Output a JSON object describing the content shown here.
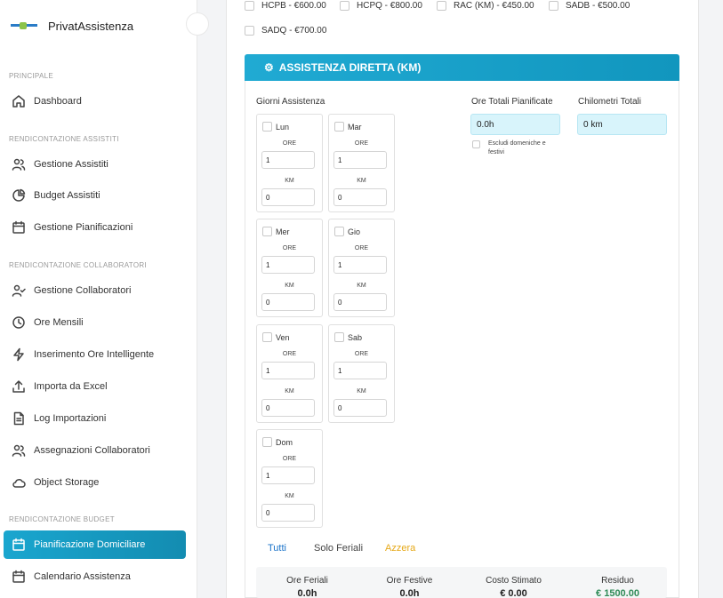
{
  "app": {
    "name": "PrivatAssistenza"
  },
  "sidebar": {
    "sections": [
      {
        "title": "PRINCIPALE"
      },
      {
        "title": "RENDICONTAZIONE ASSISTITI"
      },
      {
        "title": "RENDICONTAZIONE COLLABORATORI"
      },
      {
        "title": "RENDICONTAZIONE BUDGET"
      }
    ],
    "items": [
      {
        "label": "Dashboard",
        "icon": "home-icon"
      },
      {
        "label": "Gestione Assistiti",
        "icon": "users-icon"
      },
      {
        "label": "Budget Assistiti",
        "icon": "pie-chart-icon"
      },
      {
        "label": "Gestione Pianificazioni",
        "icon": "calendar-icon"
      },
      {
        "label": "Gestione Collaboratori",
        "icon": "user-check-icon"
      },
      {
        "label": "Ore Mensili",
        "icon": "clock-icon"
      },
      {
        "label": "Inserimento Ore Intelligente",
        "icon": "zap-icon"
      },
      {
        "label": "Importa da Excel",
        "icon": "upload-icon"
      },
      {
        "label": "Log Importazioni",
        "icon": "file-text-icon"
      },
      {
        "label": "Assegnazioni Collaboratori",
        "icon": "users-icon"
      },
      {
        "label": "Object Storage",
        "icon": "cloud-icon"
      },
      {
        "label": "Pianificazione Domiciliare",
        "icon": "calendar-icon",
        "active": true
      },
      {
        "label": "Calendario Assistenza",
        "icon": "calendar-icon"
      }
    ]
  },
  "services": [
    {
      "label": "HCPB - €600.00"
    },
    {
      "label": "HCPQ - €800.00"
    },
    {
      "label": "RAC (KM) - €450.00"
    },
    {
      "label": "SADB - €500.00"
    },
    {
      "label": "SADQ - €700.00"
    }
  ],
  "panel": {
    "title": "ASSISTENZA DIRETTA (KM)",
    "days_label": "Giorni Assistenza",
    "ore_caption": "ORE",
    "km_caption": "KM",
    "days": [
      {
        "name": "Lun",
        "ore": "1",
        "km": "0"
      },
      {
        "name": "Mar",
        "ore": "1",
        "km": "0"
      },
      {
        "name": "Mer",
        "ore": "1",
        "km": "0"
      },
      {
        "name": "Gio",
        "ore": "1",
        "km": "0"
      },
      {
        "name": "Ven",
        "ore": "1",
        "km": "0"
      },
      {
        "name": "Sab",
        "ore": "1",
        "km": "0"
      },
      {
        "name": "Dom",
        "ore": "1",
        "km": "0"
      }
    ],
    "ore_totali_label": "Ore Totali Pianificate",
    "ore_totali_value": "0.0h",
    "km_totali_label": "Chilometri Totali",
    "km_totali_value": "0 km",
    "escludi_label_1": "Escludi domeniche e",
    "escludi_label_2": "festivi",
    "btn_tutti": "Tutti",
    "btn_feriali": "Solo Feriali",
    "btn_azzera": "Azzera",
    "colors": {
      "accent": "#1aa6cf",
      "link_blue": "#1a73c9",
      "warning": "#e6a817",
      "green": "#2e8b57"
    }
  },
  "summary": [
    {
      "label": "Ore Feriali",
      "value": "0.0h"
    },
    {
      "label": "Ore Festive",
      "value": "0.0h"
    },
    {
      "label": "Costo Stimato",
      "value": "€ 0.00"
    },
    {
      "label": "Residuo",
      "value": "€ 1500.00"
    }
  ]
}
